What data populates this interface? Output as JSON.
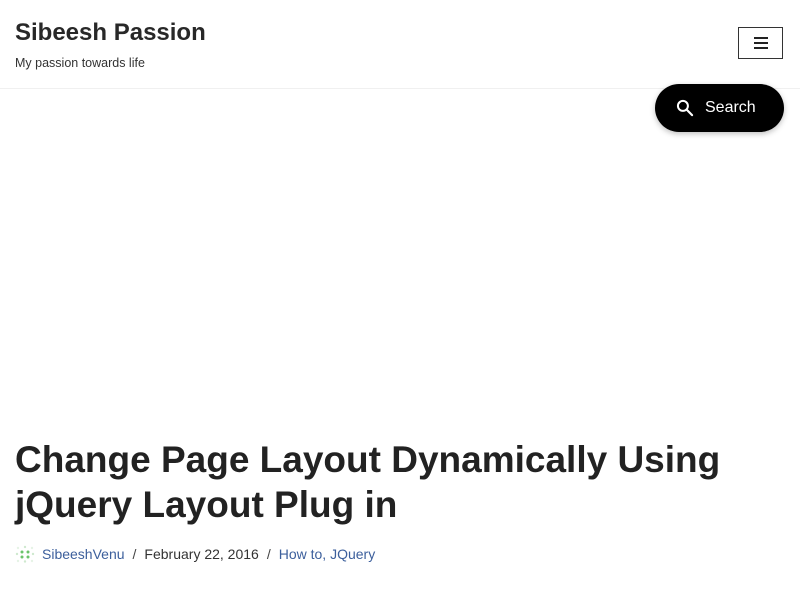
{
  "site": {
    "title": "Sibeesh Passion",
    "tagline": "My passion towards life"
  },
  "header": {
    "menu_icon": "hamburger-menu-icon"
  },
  "search": {
    "label": "Search",
    "icon": "search-icon"
  },
  "post": {
    "title": "Change Page Layout Dynamically Using jQuery Layout Plug in",
    "author": "SibeeshVenu",
    "date": "February 22, 2016",
    "separator": "/",
    "categories": "How to, JQuery"
  },
  "colors": {
    "link": "#3c5f9c",
    "search_bg": "#000000",
    "avatar_green": "#6cc46c"
  }
}
